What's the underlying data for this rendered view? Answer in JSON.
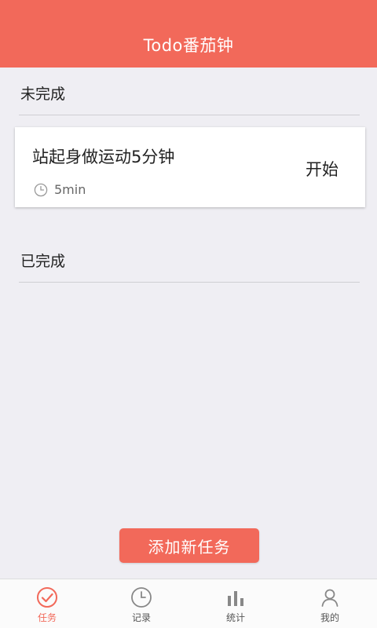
{
  "header": {
    "title": "Todo番茄钟"
  },
  "sections": {
    "unfinished_label": "未完成",
    "finished_label": "已完成"
  },
  "tasks": [
    {
      "title": "站起身做运动5分钟",
      "duration": "5min",
      "action_label": "开始"
    }
  ],
  "add_task_label": "添加新任务",
  "tabs": [
    {
      "label": "任务",
      "icon": "check-circle-icon",
      "active": true
    },
    {
      "label": "记录",
      "icon": "clock-icon",
      "active": false
    },
    {
      "label": "统计",
      "icon": "bar-chart-icon",
      "active": false
    },
    {
      "label": "我的",
      "icon": "user-icon",
      "active": false
    }
  ],
  "colors": {
    "accent": "#f2695a",
    "background": "#efeef3"
  }
}
